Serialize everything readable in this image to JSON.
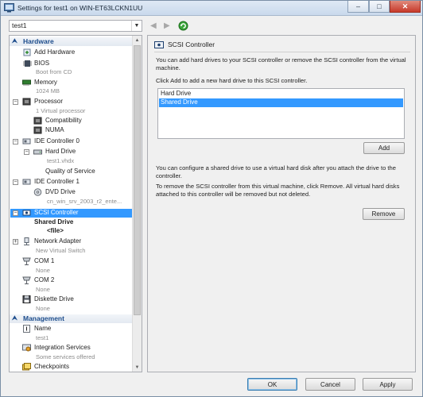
{
  "window": {
    "title": "Settings for test1 on WIN-ET63LCKN1UU",
    "min_glyph": "–",
    "max_glyph": "□",
    "close_glyph": "✕"
  },
  "toolbar": {
    "vm_selected": "test1",
    "back_glyph": "◀",
    "forward_glyph": "▶"
  },
  "tree": {
    "hardware_header": "Hardware",
    "management_header": "Management",
    "items": {
      "add_hardware": "Add Hardware",
      "bios": "BIOS",
      "bios_sub": "Boot from CD",
      "memory": "Memory",
      "memory_sub": "1024 MB",
      "processor": "Processor",
      "processor_sub": "1 Virtual processor",
      "compatibility": "Compatibility",
      "numa": "NUMA",
      "ide0": "IDE Controller 0",
      "hard_drive": "Hard Drive",
      "hard_drive_sub": "test1.vhdx",
      "qos": "Quality of Service",
      "ide1": "IDE Controller 1",
      "dvd_drive": "DVD Drive",
      "dvd_drive_sub": "cn_win_srv_2003_r2_ente...",
      "scsi": "SCSI Controller",
      "shared_drive": "Shared Drive",
      "file": "<file>",
      "network": "Network Adapter",
      "network_sub": "New Virtual Switch",
      "com1": "COM 1",
      "com1_sub": "None",
      "com2": "COM 2",
      "com2_sub": "None",
      "diskette": "Diskette Drive",
      "diskette_sub": "None",
      "name": "Name",
      "name_sub": "test1",
      "integration": "Integration Services",
      "integration_sub": "Some services offered",
      "checkpoints": "Checkpoints"
    }
  },
  "panel": {
    "header": "SCSI Controller",
    "intro": "You can add hard drives to your SCSI controller or remove the SCSI controller from the virtual machine.",
    "add_hint": "Click Add to add a new hard drive to this SCSI controller.",
    "list": [
      "Hard Drive",
      "Shared Drive"
    ],
    "add_label": "Add",
    "shared_info": "You can configure a shared drive to use a virtual hard disk after you attach the drive to the controller.",
    "remove_info": "To remove the SCSI controller from this virtual machine, click Remove. All virtual hard disks attached to this controller will be removed but not deleted.",
    "remove_label": "Remove"
  },
  "footer": {
    "ok_label": "OK",
    "cancel_label": "Cancel",
    "apply_label": "Apply"
  },
  "colors": {
    "selection": "#3399ff",
    "section_header_text": "#1c4c8c",
    "link": "#1b4fbf"
  }
}
